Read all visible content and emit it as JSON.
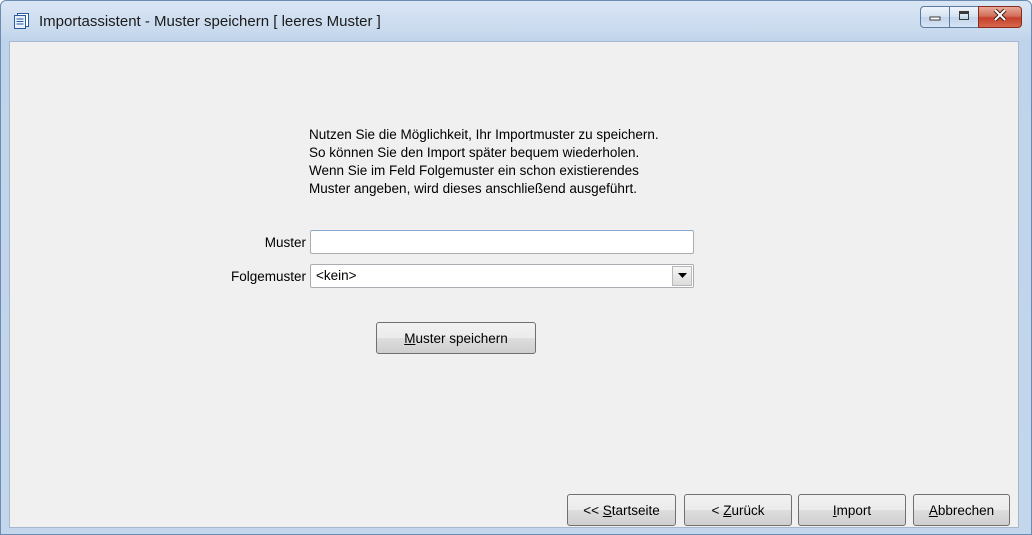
{
  "window": {
    "title": "Importassistent - Muster speichern [ leeres Muster ]",
    "controls": {
      "minimize": "minimize-icon",
      "maximize": "maximize-icon",
      "close": "close-icon"
    }
  },
  "info": {
    "lines": [
      "Nutzen Sie die Möglichkeit, Ihr Importmuster zu speichern.",
      "So können Sie den Import später bequem wiederholen.",
      "Wenn Sie im Feld Folgemuster ein schon existierendes",
      "Muster angeben, wird dieses anschließend ausgeführt."
    ]
  },
  "form": {
    "muster": {
      "label": "Muster",
      "value": ""
    },
    "folgemuster": {
      "label": "Folgemuster",
      "value": "<kein>"
    },
    "save_button": {
      "prefix": "",
      "mnemonic": "M",
      "rest": "uster speichern"
    }
  },
  "footer": {
    "startseite": {
      "prefix": "<< ",
      "mnemonic": "S",
      "rest": "tartseite"
    },
    "zurueck": {
      "prefix": "< ",
      "mnemonic": "Z",
      "rest": "urück"
    },
    "import": {
      "prefix": "",
      "mnemonic": "I",
      "rest": "mport"
    },
    "abbrechen": {
      "prefix": "",
      "mnemonic": "A",
      "rest": "bbrechen"
    }
  },
  "colors": {
    "frame": "#c3d6ec",
    "content": "#f0f0f0",
    "close_button": "#c5402a"
  }
}
